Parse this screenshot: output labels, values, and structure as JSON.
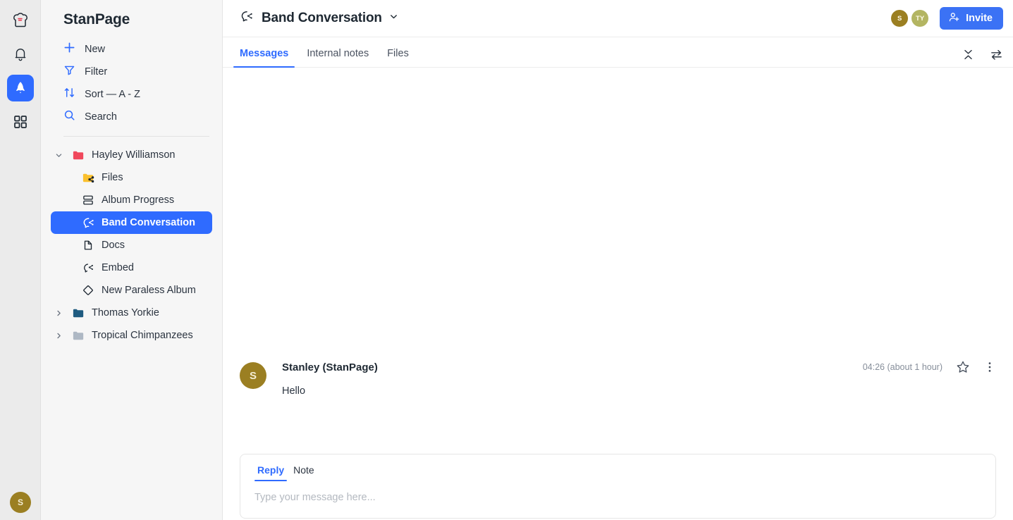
{
  "colors": {
    "accent": "#2f6bff",
    "invite_bg": "#3b72f5",
    "rail_bg": "#ebebeb",
    "sidebar_bg": "#f6f6f6",
    "folder_red": "#f0485c",
    "folder_yellow": "#fbc02d",
    "folder_navy": "#1f5b80",
    "folder_gray": "#aeb8c4",
    "avatar_gold": "#9b7f22",
    "avatar_olive": "#b3b562"
  },
  "rail": {
    "items": [
      {
        "icon": "chef-hat-logo-icon"
      },
      {
        "icon": "bell-icon"
      },
      {
        "icon": "rocket-icon",
        "active": true
      },
      {
        "icon": "grid-apps-icon"
      }
    ],
    "avatar": {
      "initials": "S"
    }
  },
  "sidebar": {
    "brand": "StanPage",
    "actions": [
      {
        "icon": "plus-icon",
        "label": "New"
      },
      {
        "icon": "filter-icon",
        "label": "Filter"
      },
      {
        "icon": "sort-icon",
        "label": "Sort — A - Z"
      },
      {
        "icon": "search-icon",
        "label": "Search"
      }
    ],
    "tree": [
      {
        "label": "Hayley Williamson",
        "icon": "folder-icon",
        "folder_color": "#f0485c",
        "expanded": true,
        "twisty": "⌄"
      },
      {
        "label": "Files",
        "icon": "shared-folder-icon",
        "child": true
      },
      {
        "label": "Album Progress",
        "icon": "board-icon",
        "child": true
      },
      {
        "label": "Band Conversation",
        "icon": "conversation-icon",
        "child": true,
        "selected": true
      },
      {
        "label": "Docs",
        "icon": "doc-icon",
        "child": true
      },
      {
        "label": "Embed",
        "icon": "embed-icon",
        "child": true
      },
      {
        "label": "New Paraless Album",
        "icon": "diamond-icon",
        "child": true
      },
      {
        "label": "Thomas Yorkie",
        "icon": "folder-icon",
        "folder_color": "#1f5b80",
        "twisty": "›"
      },
      {
        "label": "Tropical Chimpanzees",
        "icon": "folder-icon",
        "folder_color": "#aeb8c4",
        "twisty": "›"
      }
    ]
  },
  "topbar": {
    "title": "Band Conversation",
    "title_icon": "conversation-icon",
    "chevron": "chevron-down-icon",
    "avatars": [
      {
        "initials": "S",
        "color": "#9b7f22"
      },
      {
        "initials": "TY",
        "color": "#b3b562"
      }
    ],
    "invite_label": "Invite",
    "invite_icon": "person-plus-icon"
  },
  "tabs": [
    {
      "label": "Messages",
      "active": true
    },
    {
      "label": "Internal notes",
      "active": false
    },
    {
      "label": "Files",
      "active": false
    }
  ],
  "tab_icons": [
    {
      "name": "collapse-vertical-icon"
    },
    {
      "name": "transfer-icon"
    }
  ],
  "message": {
    "avatar_initials": "S",
    "author": "Stanley (StanPage)",
    "timestamp": "04:26 (about 1 hour)",
    "text": "Hello",
    "star_icon": "star-icon",
    "more_icon": "more-vertical-icon"
  },
  "composer": {
    "tabs": [
      {
        "label": "Reply",
        "active": true
      },
      {
        "label": "Note",
        "active": false
      }
    ],
    "placeholder": "Type your message here...",
    "value": ""
  }
}
